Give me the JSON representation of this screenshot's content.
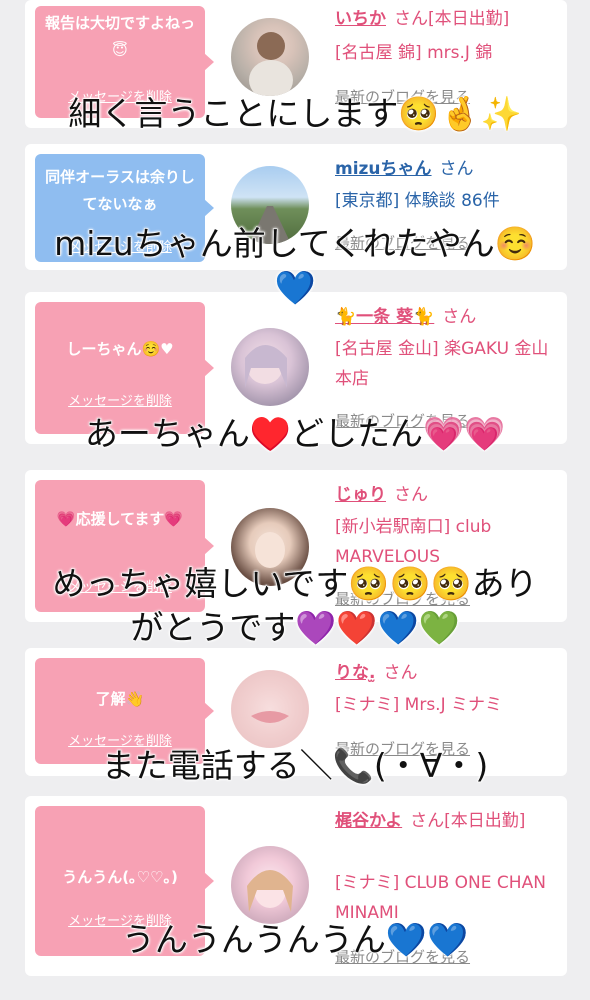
{
  "cards": [
    {
      "bubble_color": "#f7a1b4",
      "bubble_text": "報告は大切ですよねっ😇",
      "delete_label": "メッセージを削除",
      "name": "いちか",
      "suffix": "さん[本日出勤]",
      "shop": "[名古屋 錦] mrs.J 錦",
      "blog_label": "最新のブログを見る",
      "avatar_icon": "woman-portrait-photo"
    },
    {
      "bubble_color": "#8fbdf0",
      "bubble_text": "同伴オーラスは余りしてないなぁ",
      "delete_label": "メッセージを削除",
      "name": "mizuちゃん",
      "suffix": "さん",
      "shop": "[東京都] 体験談 86件",
      "blog_label": "最新のブログを見る",
      "avatar_icon": "road-landscape-photo"
    },
    {
      "bubble_color": "#f7a1b4",
      "bubble_text": "しーちゃん☺️♥",
      "delete_label": "メッセージを削除",
      "name": "🐈一条 葵🐈",
      "suffix": "さん",
      "shop": "[名古屋 金山] 楽GAKU 金山本店",
      "blog_label": "最新のブログを見る",
      "avatar_icon": "woman-portrait-photo"
    },
    {
      "bubble_color": "#f7a1b4",
      "bubble_text": "💗応援してます💗",
      "delete_label": "メッセージを削除",
      "name": "じゅり",
      "suffix": "さん",
      "shop": "[新小岩駅南口] club MARVELOUS",
      "blog_label": "最新のブログを見る",
      "avatar_icon": "woman-portrait-photo"
    },
    {
      "bubble_color": "#f7a1b4",
      "bubble_text": "了解👋",
      "delete_label": "メッセージを削除",
      "name": "りな.̫",
      "suffix": "さん",
      "shop": "[ミナミ] Mrs.J ミナミ",
      "blog_label": "最新のブログを見る",
      "avatar_icon": "lips-closeup-photo"
    },
    {
      "bubble_color": "#f7a1b4",
      "bubble_text": "うんうん(｡♡♡｡)",
      "delete_label": "メッセージを削除",
      "name": "梶谷かよ",
      "suffix": "さん[本日出勤]",
      "shop": "[ミナミ] CLUB ONE CHAN MINAMI",
      "blog_label": "最新のブログを見る",
      "avatar_icon": "woman-portrait-photo"
    }
  ],
  "captions": [
    "細く言うことにします🥺🤞✨",
    "mizuちゃん前してくれたやん☺️",
    "💙",
    "あーちゃん♥️どしたん💗💗",
    "めっちゃ嬉しいです🥺🥺🥺あり",
    "がとうです💜❤️💙💚",
    "また電話する＼📞(・∀・)",
    "うんうんうんうん💙💙"
  ]
}
